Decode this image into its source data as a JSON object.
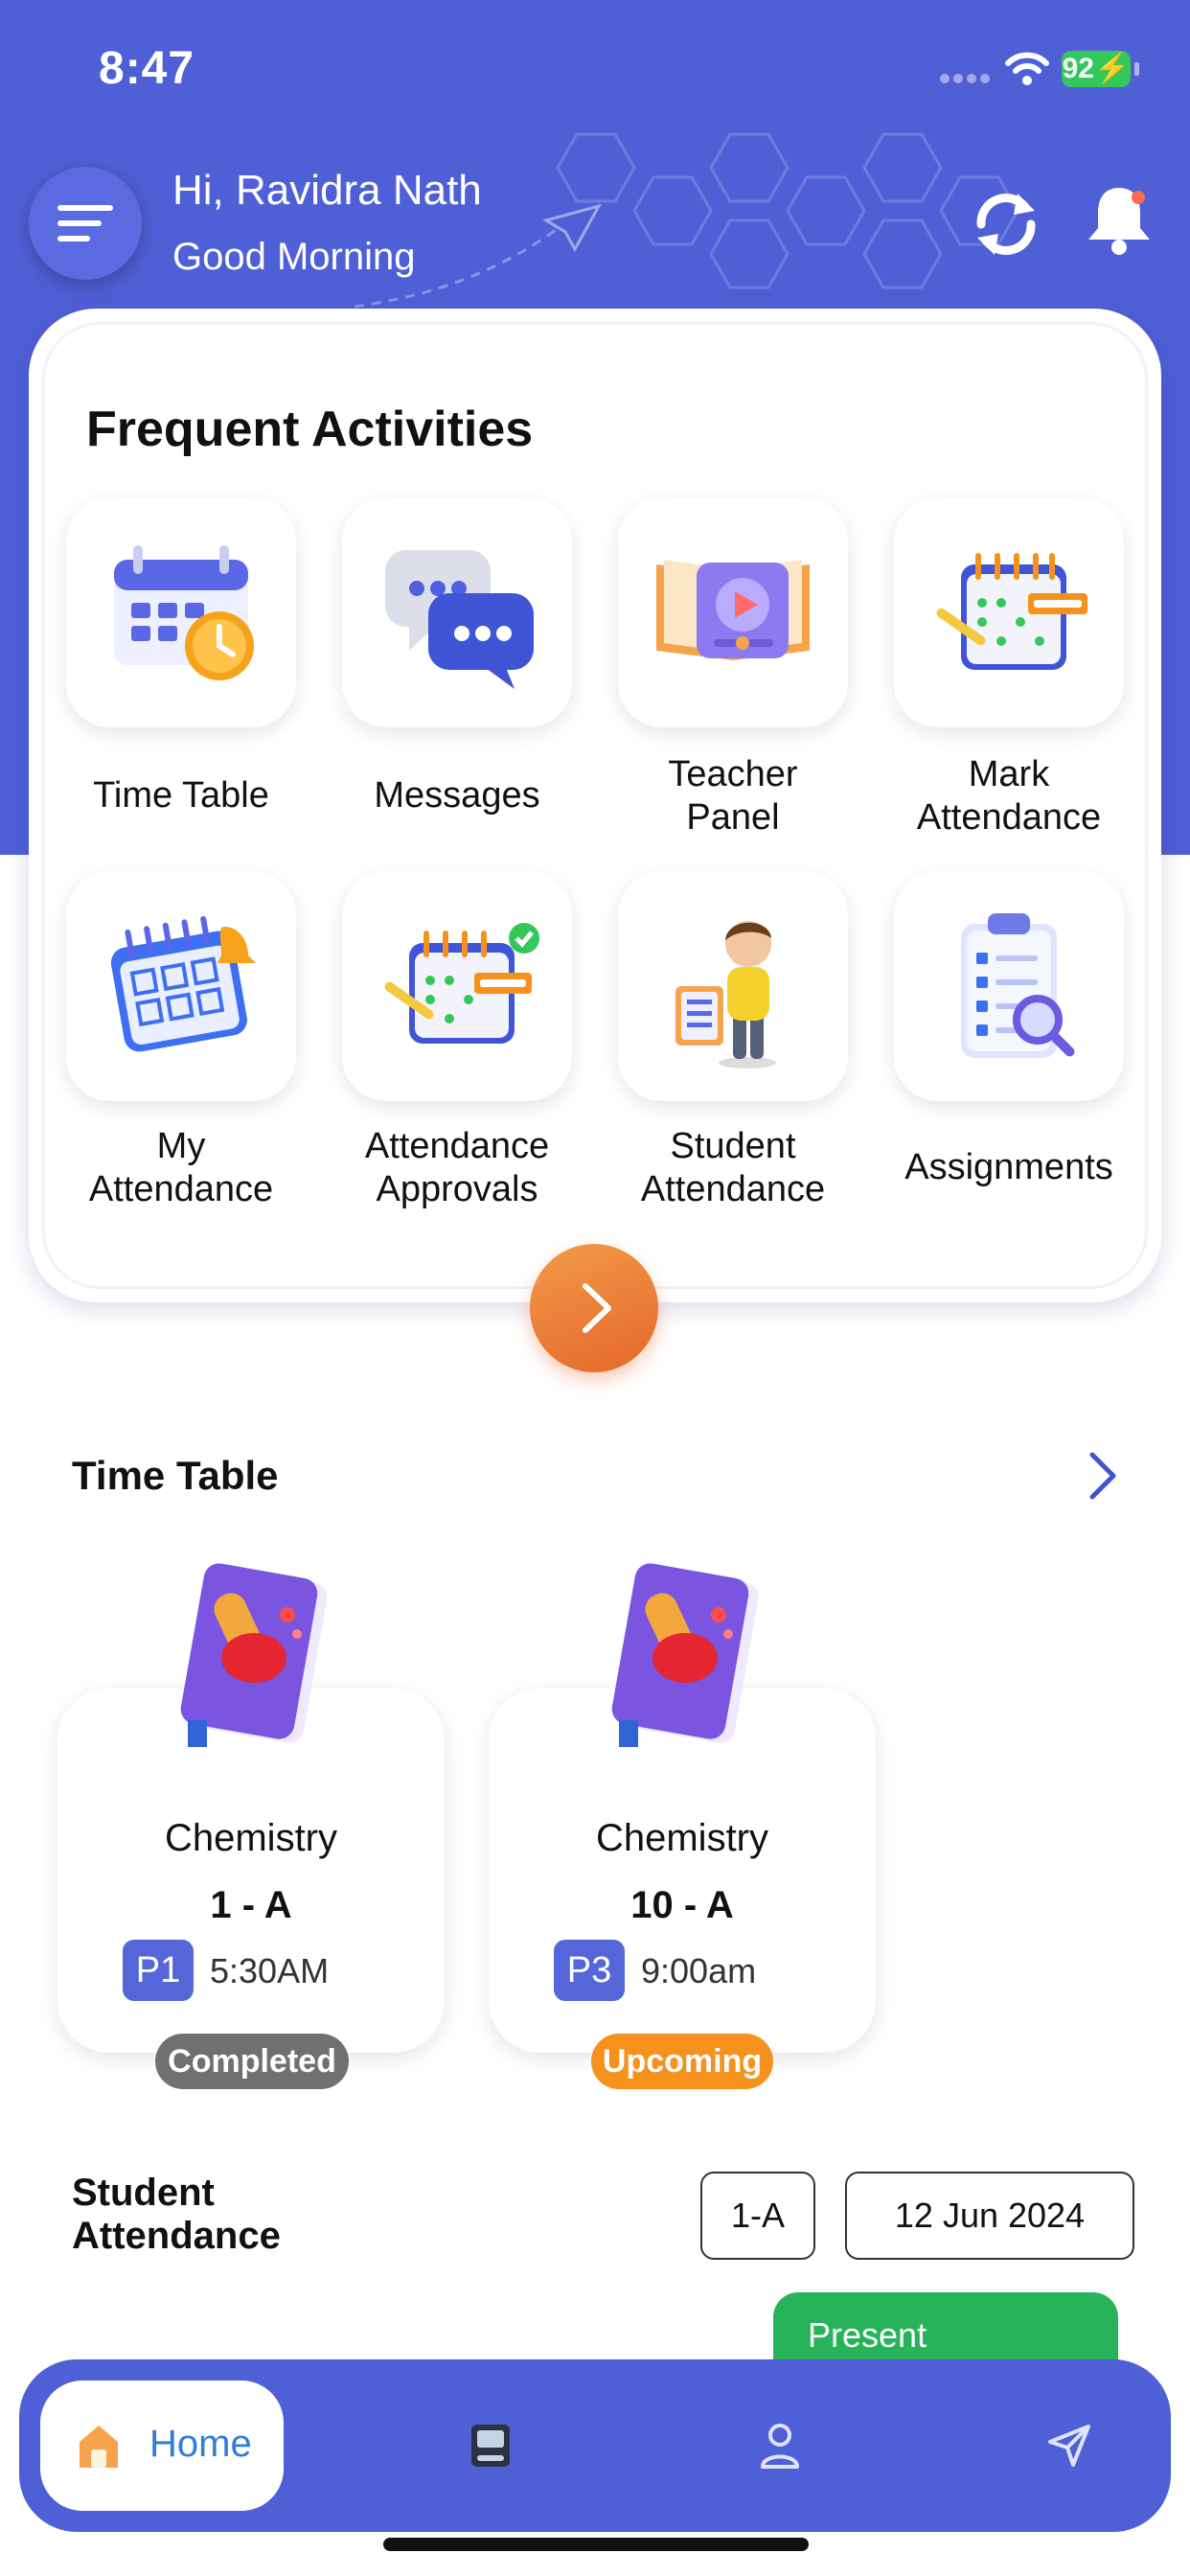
{
  "status_bar": {
    "time": "8:47",
    "battery": "92"
  },
  "header": {
    "greeting": "Hi, Ravidra Nath",
    "subtitle": "Good Morning"
  },
  "frequent": {
    "title": "Frequent Activities",
    "items": [
      {
        "line1": "Time Table",
        "line2": "",
        "icon": "calendar-clock-icon"
      },
      {
        "line1": "Messages",
        "line2": "",
        "icon": "chat-bubbles-icon"
      },
      {
        "line1": "Teacher",
        "line2": "Panel",
        "icon": "book-video-icon"
      },
      {
        "line1": "Mark",
        "line2": "Attendance",
        "icon": "attendance-sheet-icon"
      },
      {
        "line1": "My",
        "line2": "Attendance",
        "icon": "calendar-check-icon"
      },
      {
        "line1": "Attendance",
        "line2": "Approvals",
        "icon": "approval-sheet-icon"
      },
      {
        "line1": "Student",
        "line2": "Attendance",
        "icon": "student-figure-icon"
      },
      {
        "line1": "Assignments",
        "line2": "",
        "icon": "clipboard-search-icon"
      }
    ]
  },
  "timetable": {
    "title": "Time Table",
    "cards": [
      {
        "subject": "Chemistry",
        "class": "1 - A",
        "period": "P1",
        "time": "5:30AM",
        "status": "Completed",
        "status_color": "#707070"
      },
      {
        "subject": "Chemistry",
        "class": "10 - A",
        "period": "P3",
        "time": "9:00am",
        "status": "Upcoming",
        "status_color": "#f5921e"
      }
    ]
  },
  "student_attendance": {
    "title_line1": "Student",
    "title_line2": "Attendance",
    "class_filter": "1-A",
    "date_filter": "12 Jun 2024",
    "status_label": "Present"
  },
  "bottom_nav": {
    "home_label": "Home",
    "items": [
      "home-icon",
      "book-icon",
      "profile-icon",
      "send-icon"
    ]
  },
  "colors": {
    "primary": "#4f5fd6",
    "accent_orange": "#e5672a",
    "present_green": "#27b35a"
  }
}
